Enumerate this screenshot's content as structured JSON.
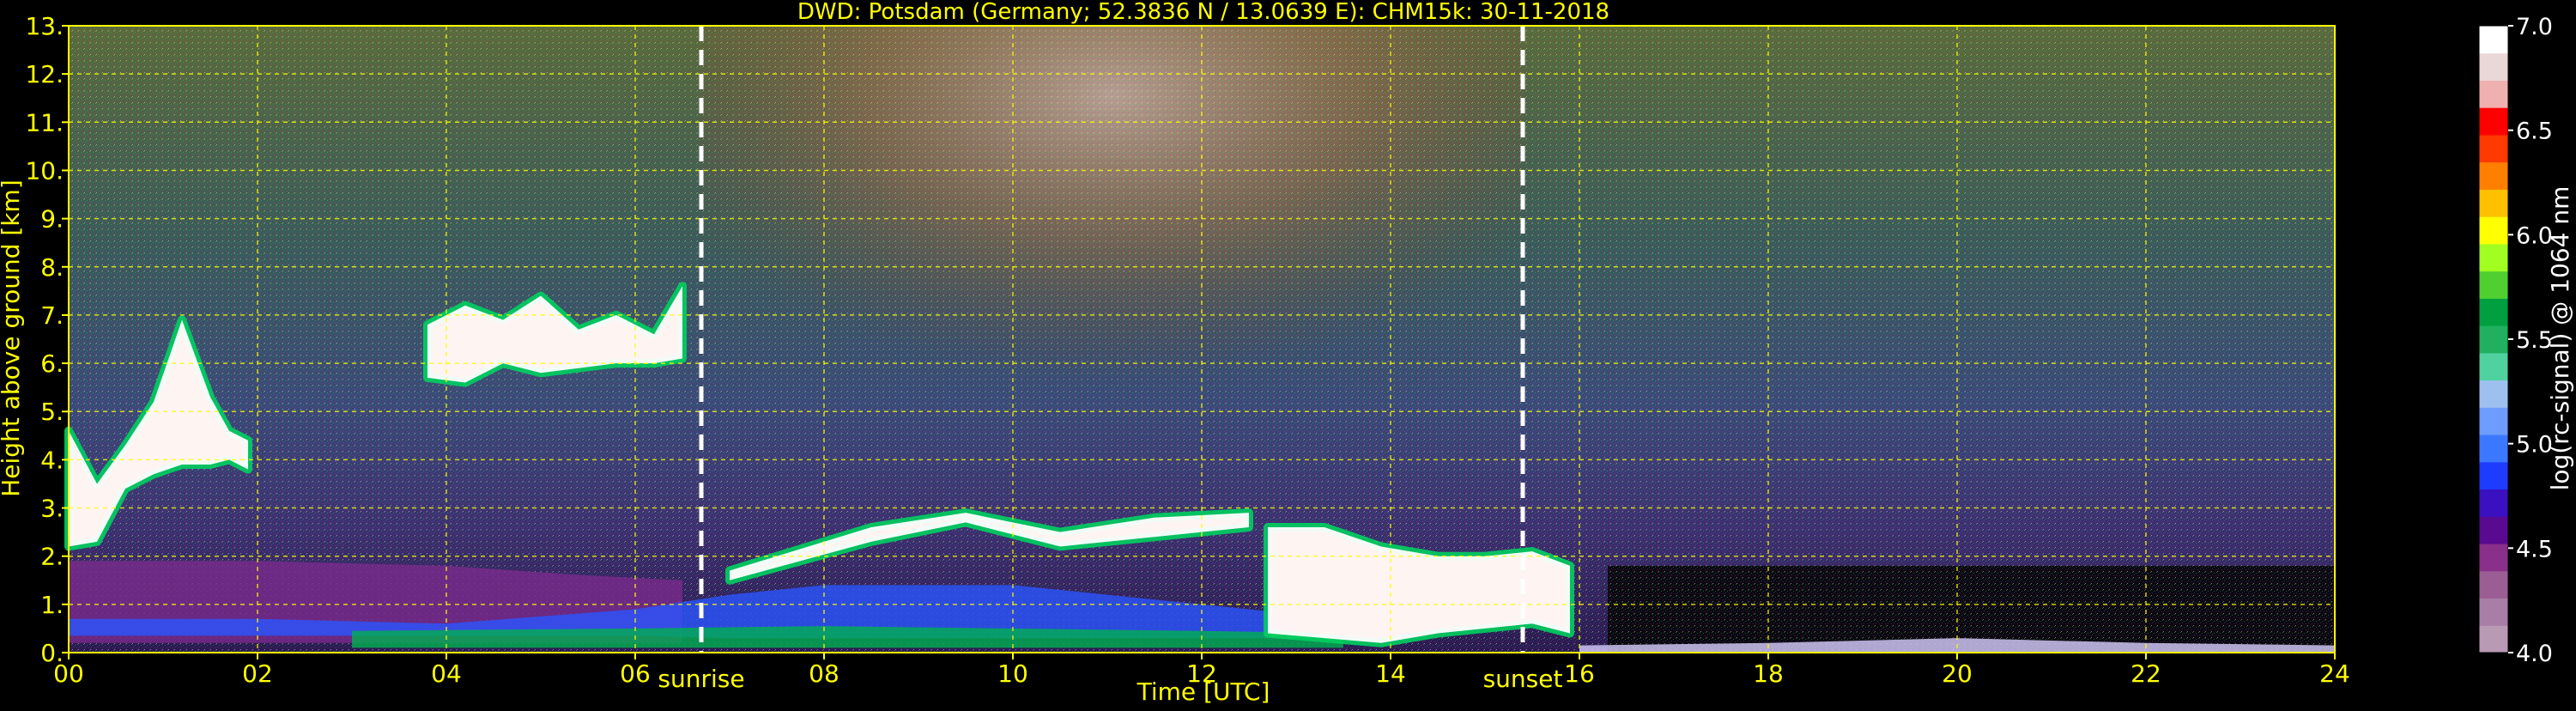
{
  "chart_data": {
    "type": "heatmap",
    "title": "DWD: Potsdam (Germany; 52.3836 N / 13.0639 E):    CHM15k: 30-11-2018",
    "xlabel": "Time [UTC]",
    "ylabel": "Height above ground [km]",
    "xlim": [
      0,
      24
    ],
    "ylim": [
      0,
      13
    ],
    "x_ticks": [
      "00",
      "02",
      "04",
      "06",
      "08",
      "10",
      "12",
      "14",
      "16",
      "18",
      "20",
      "22",
      "24"
    ],
    "y_ticks": [
      "0.",
      "1.",
      "2.",
      "3.",
      "4.",
      "5.",
      "6.",
      "7.",
      "8.",
      "9.",
      "10.",
      "11.",
      "12.",
      "13."
    ],
    "grid": true,
    "grid_color": "#ffff00",
    "annotations": [
      {
        "label": "sunrise",
        "x": 6.7
      },
      {
        "label": "sunset",
        "x": 15.4
      }
    ],
    "colorbar": {
      "label": "log(rc-signal) @ 1064 nm",
      "range": [
        4.0,
        7.0
      ],
      "ticks": [
        "4.0",
        "4.5",
        "5.0",
        "5.5",
        "6.0",
        "6.5",
        "7.0"
      ],
      "colors": [
        "#b89ab4",
        "#a97ea6",
        "#9a5e95",
        "#8a2f8a",
        "#5a0a90",
        "#3a10c0",
        "#1d3cff",
        "#3c78ff",
        "#6e9cff",
        "#9ec0f0",
        "#4fd1a0",
        "#20b060",
        "#00a040",
        "#50d030",
        "#a0ff20",
        "#ffff00",
        "#ffc000",
        "#ff8000",
        "#ff3a00",
        "#ff0000",
        "#f0b0b0",
        "#ead8d8",
        "#ffffff"
      ]
    },
    "layers": [
      {
        "name": "cloud",
        "color": "#ffffff",
        "x": [
          0.0,
          0.3,
          0.6,
          0.9,
          1.2,
          1.5,
          1.7,
          1.9
        ],
        "y_low": [
          2.2,
          2.3,
          3.4,
          3.7,
          3.9,
          3.9,
          4.0,
          3.8
        ],
        "y_high": [
          4.6,
          3.5,
          4.3,
          5.2,
          6.9,
          5.3,
          4.6,
          4.4
        ]
      },
      {
        "name": "cloud",
        "color": "#ffffff",
        "x": [
          3.8,
          4.2,
          4.6,
          5.0,
          5.4,
          5.8,
          6.2,
          6.5
        ],
        "y_low": [
          5.7,
          5.6,
          6.0,
          5.8,
          5.9,
          6.0,
          6.0,
          6.1
        ],
        "y_high": [
          6.8,
          7.2,
          6.9,
          7.4,
          6.7,
          7.0,
          6.6,
          7.6
        ]
      },
      {
        "name": "aerosol",
        "color": "#7a2a8c",
        "x": [
          0.0,
          2.0,
          4.0,
          5.5,
          6.5
        ],
        "y_low": [
          0.2,
          0.2,
          0.2,
          0.2,
          0.2
        ],
        "y_high": [
          1.9,
          1.9,
          1.8,
          1.6,
          1.5
        ]
      },
      {
        "name": "boundary",
        "color": "#2a55ff",
        "x": [
          0.0,
          2.0,
          4.0,
          6.0,
          7.0,
          8.0,
          10.0,
          12.0,
          13.0
        ],
        "y_low": [
          0.35,
          0.35,
          0.35,
          0.35,
          0.3,
          0.3,
          0.3,
          0.3,
          0.3
        ],
        "y_high": [
          0.7,
          0.7,
          0.6,
          0.9,
          1.2,
          1.4,
          1.4,
          1.0,
          0.8
        ]
      },
      {
        "name": "surface",
        "color": "#00b050",
        "x": [
          3.0,
          6.0,
          8.0,
          10.0,
          12.0,
          13.5
        ],
        "y_low": [
          0.1,
          0.1,
          0.1,
          0.1,
          0.1,
          0.1
        ],
        "y_high": [
          0.45,
          0.5,
          0.55,
          0.5,
          0.45,
          0.4
        ]
      },
      {
        "name": "cloud",
        "color": "#ffffff",
        "x": [
          7.0,
          8.5,
          9.5,
          10.5,
          11.5,
          12.5
        ],
        "y_low": [
          1.5,
          2.3,
          2.7,
          2.2,
          2.4,
          2.6
        ],
        "y_high": [
          1.7,
          2.6,
          2.9,
          2.5,
          2.8,
          2.9
        ]
      },
      {
        "name": "cloud",
        "color": "#ffffff",
        "x": [
          12.7,
          13.3,
          13.9,
          14.5,
          15.0,
          15.5,
          15.9
        ],
        "y_low": [
          0.4,
          0.3,
          0.2,
          0.4,
          0.5,
          0.6,
          0.4
        ],
        "y_high": [
          2.6,
          2.6,
          2.2,
          2.0,
          2.0,
          2.1,
          1.8
        ]
      },
      {
        "name": "surface",
        "color": "#d8d0ff",
        "x": [
          16.0,
          18.0,
          20.0,
          22.0,
          24.0
        ],
        "y_low": [
          0.0,
          0.0,
          0.0,
          0.0,
          0.0
        ],
        "y_high": [
          0.15,
          0.2,
          0.3,
          0.2,
          0.15
        ]
      }
    ]
  }
}
